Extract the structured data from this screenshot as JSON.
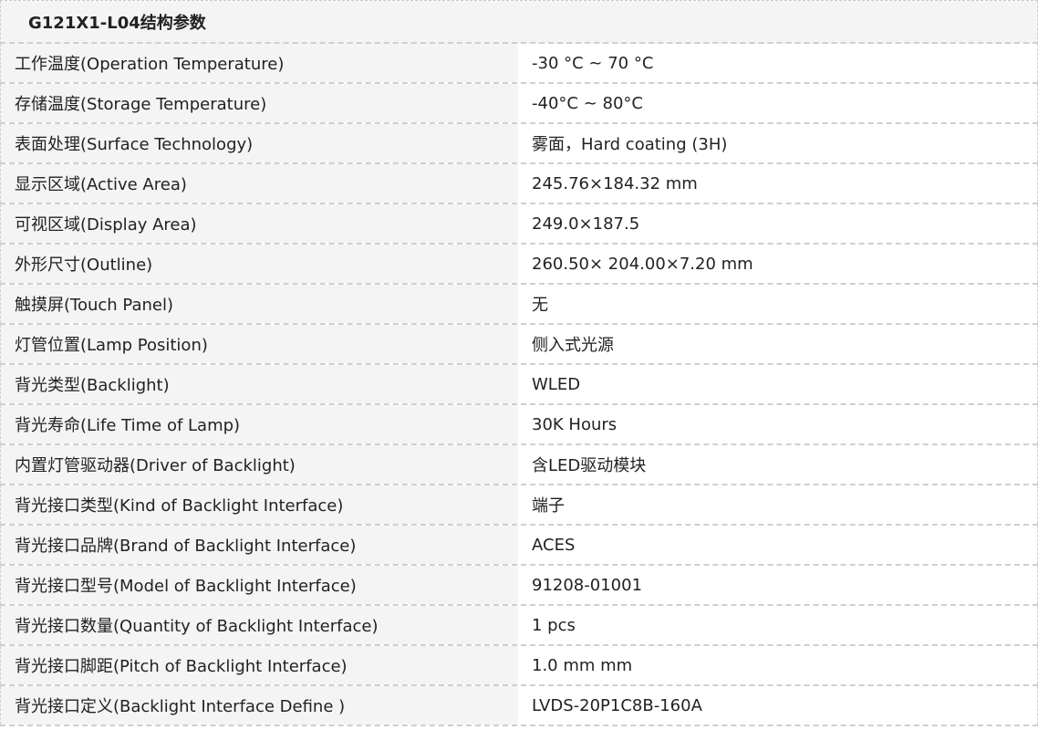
{
  "title": "G121X1-L04结构参数",
  "rows": [
    {
      "label": "工作温度(Operation Temperature)",
      "value": "-30 °C ~ 70 °C"
    },
    {
      "label": "存储温度(Storage Temperature)",
      "value": "-40°C ~ 80°C"
    },
    {
      "label": "表面处理(Surface Technology)",
      "value": "雾面，Hard coating (3H)"
    },
    {
      "label": "显示区域(Active Area)",
      "value": "245.76×184.32 mm"
    },
    {
      "label": "可视区域(Display Area)",
      "value": "249.0×187.5"
    },
    {
      "label": "外形尺寸(Outline)",
      "value": "260.50× 204.00×7.20 mm"
    },
    {
      "label": "触摸屏(Touch Panel)",
      "value": "无"
    },
    {
      "label": "灯管位置(Lamp Position)",
      "value": "侧入式光源"
    },
    {
      "label": "背光类型(Backlight)",
      "value": "WLED"
    },
    {
      "label": "背光寿命(Life Time of Lamp)",
      "value": "30K Hours"
    },
    {
      "label": "内置灯管驱动器(Driver of Backlight)",
      "value": "含LED驱动模块"
    },
    {
      "label": "背光接口类型(Kind of Backlight Interface)",
      "value": "端子"
    },
    {
      "label": "背光接口品牌(Brand of Backlight Interface)",
      "value": "ACES"
    },
    {
      "label": "背光接口型号(Model of Backlight Interface)",
      "value": "91208-01001"
    },
    {
      "label": "背光接口数量(Quantity of Backlight Interface)",
      "value": "1 pcs"
    },
    {
      "label": "背光接口脚距(Pitch of Backlight Interface)",
      "value": "1.0 mm mm"
    },
    {
      "label": "背光接口定义(Backlight Interface Define )",
      "value": "LVDS-20P1C8B-160A"
    }
  ]
}
